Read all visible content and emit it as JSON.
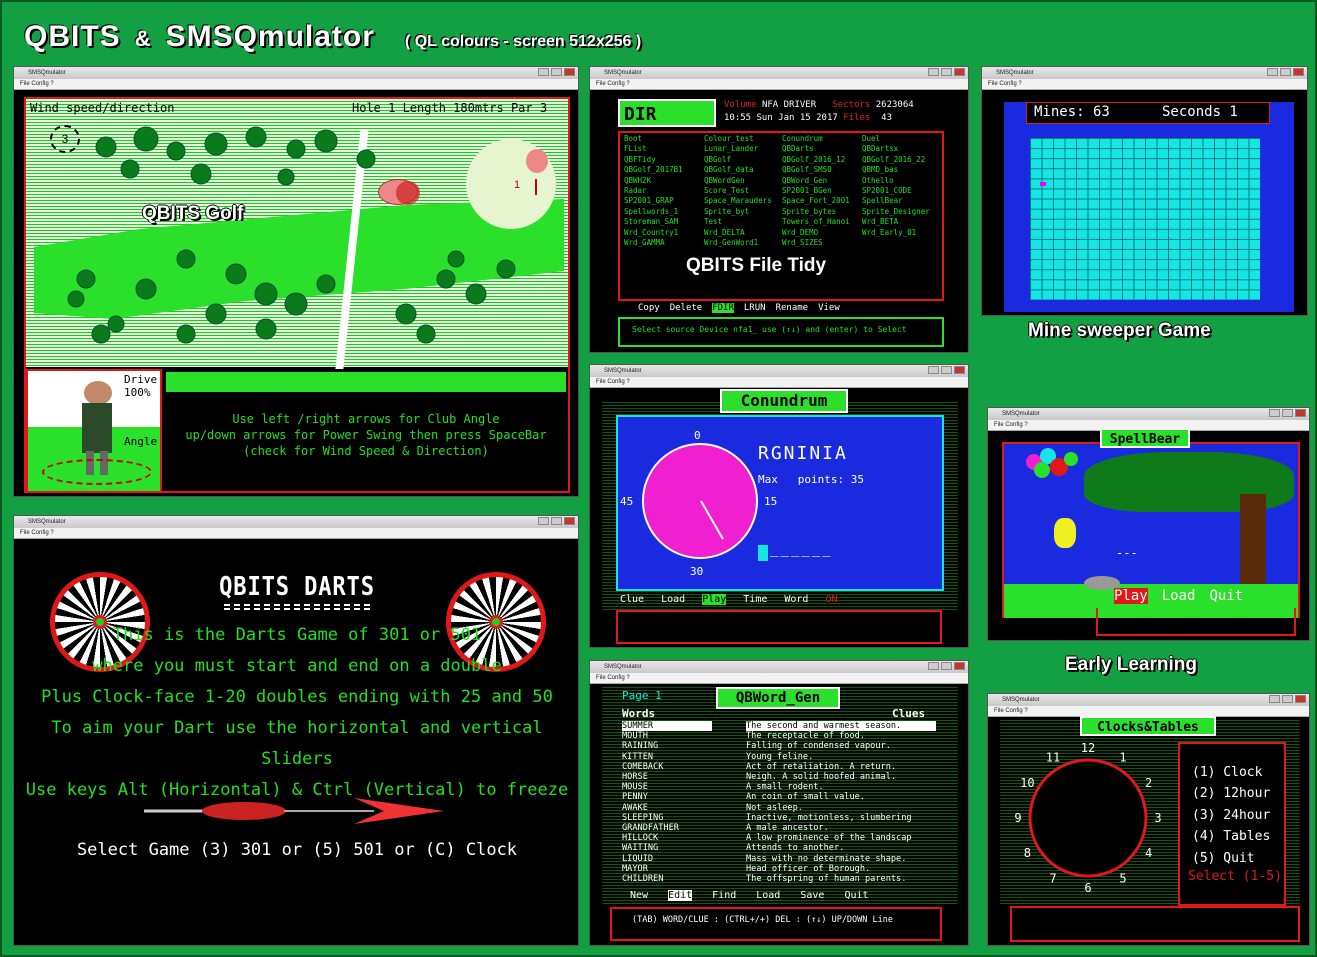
{
  "header": {
    "title": "QBITS",
    "amp": "&",
    "app": "SMSQmulator",
    "subtitle": "( QL  colours  - screen 512x256 )"
  },
  "window": {
    "app": "SMSQmulator",
    "menu": "File  Config  ?"
  },
  "golf": {
    "wind": "Wind speed/direction",
    "hole": "Hole 1  Length 180mtrs  Par 3",
    "drive": "Drive",
    "power": "100%",
    "angle": "Angle",
    "wind_value": "3",
    "flag": "1",
    "caption": "QBITS Golf",
    "instructions": [
      "Use left /right arrows  for Club Angle",
      "up/down arrows for Power Swing then press SpaceBar",
      "(check  for Wind Speed & Direction)"
    ]
  },
  "darts": {
    "heading": "QBITS DARTS",
    "lines": [
      "This is the Darts Game of 301 or 501",
      "where you must start and end on a double",
      "Plus Clock-face 1-20 doubles ending with 25 and 50",
      "To aim your Dart use the horizontal and vertical Sliders",
      "Use keys Alt (Horizontal) & Ctrl (Vertical) to freeze"
    ],
    "select": "Select Game (3) 301 or (5) 501 or (C) Clock"
  },
  "filetidy": {
    "dir": "DIR nfa1_",
    "volume_label": "Volume",
    "volume": "NFA DRIVER",
    "sectors_label": "Sectors",
    "sectors": "2623064",
    "datetime": "10:55 Sun Jan 15 2017",
    "files_label": "Files",
    "files": "43",
    "col1": [
      "Boot",
      "FList",
      "QBFTidy",
      "QBGolf_2017B1",
      "QBWH2K",
      "Radar",
      "SP2001_GRAP",
      "Spellwords_1",
      "Storeman_SAM",
      "Wrd_Country1",
      "Wrd_GAMMA"
    ],
    "col2": [
      "Colour_test",
      "Lunar_Lander",
      "QBGolf",
      "QBGolf_data",
      "QBWordGen",
      "Score_Test",
      "Space_Marauders",
      "Sprite_byt",
      "Test",
      "Wrd_DELTA",
      "Wrd_GenWord1"
    ],
    "col3": [
      "Conundrum",
      "QBDarts",
      "QBGolf_2016_12",
      "QBGolf_SMS0",
      "QBWord_Gen",
      "SP2001_BGen",
      "Space_Fort_2001",
      "Sprite_bytes",
      "Towers_of_Hanoi",
      "Wrd_DEMO",
      "Wrd_SIZES"
    ],
    "col4": [
      "Duel",
      "QBDartsx",
      "QBGolf_2016_22",
      "QBMD_bas",
      "Othello",
      "SP2001_CODE",
      "SpellBear",
      "Sprite_Designer",
      "Wrd_BETA",
      "Wrd_Early_01"
    ],
    "caption": "QBITS File Tidy",
    "menu": [
      "Copy",
      "Delete",
      "FDIR",
      "LRUN",
      "Rename",
      "View"
    ],
    "prompt": "Select source Device  nfa1_   use (↑↓) and (enter) to Select"
  },
  "mines": {
    "mines": "Mines: 63",
    "seconds": "Seconds  1",
    "caption": "Mine sweeper Game"
  },
  "conundrum": {
    "title": "Conundrum",
    "word": "RGNINIA",
    "max": "Max",
    "points": "points: 35",
    "t0": "0",
    "t15": "15",
    "t30": "30",
    "t45": "45",
    "menu": [
      "Clue",
      "Load",
      "Play",
      "Time",
      "Word",
      "ON"
    ],
    "blanks": "______"
  },
  "spellbear": {
    "title": "SpellBear",
    "dashes": "---",
    "menu": [
      "Play",
      "Load",
      "Quit"
    ],
    "caption": "Early Learning"
  },
  "qbword": {
    "page": "Page  1",
    "title": "QBWord_Gen",
    "words_h": "Words",
    "clues_h": "Clues",
    "words": [
      "SUMMER",
      "MOUTH",
      "RAINING",
      "KITTEN",
      "COMEBACK",
      "HORSE",
      "MOUSE",
      "PENNY",
      "AWAKE",
      "SLEEPING",
      "GRANDFATHER",
      "HILLOCK",
      "WAITING",
      "LIQUID",
      "MAYOR",
      "CHILDREN"
    ],
    "clues": [
      "The second and warmest season.",
      "The receptacle of food.",
      "Falling of condensed vapour.",
      "Young feline.",
      "Act of retaliation. A return.",
      "Neigh. A solid hoofed animal.",
      "A small rodent.",
      "An coin of small value.",
      "Not asleep.",
      "Inactive, motionless, slumbering",
      "A male ancestor.",
      "A low prominence of the landscap",
      "Attends to another.",
      "Mass with no determinate shape.",
      "Head officer of Borough.",
      "The offspring of human parents."
    ],
    "menu": [
      "New",
      "Edit",
      "Find",
      "Load",
      "Save",
      "Quit"
    ],
    "help": "(TAB) WORD/CLUE : (CTRL+/+) DEL : (↑↓) UP/DOWN Line"
  },
  "clock": {
    "title": "Clocks&Tables",
    "nums": [
      "12",
      "1",
      "2",
      "3",
      "4",
      "5",
      "6",
      "7",
      "8",
      "9",
      "10",
      "11"
    ],
    "options": [
      "(1) Clock",
      "(2) 12hour",
      "(3) 24hour",
      "(4) Tables",
      "(5) Quit"
    ],
    "select": "Select (1-5)"
  }
}
